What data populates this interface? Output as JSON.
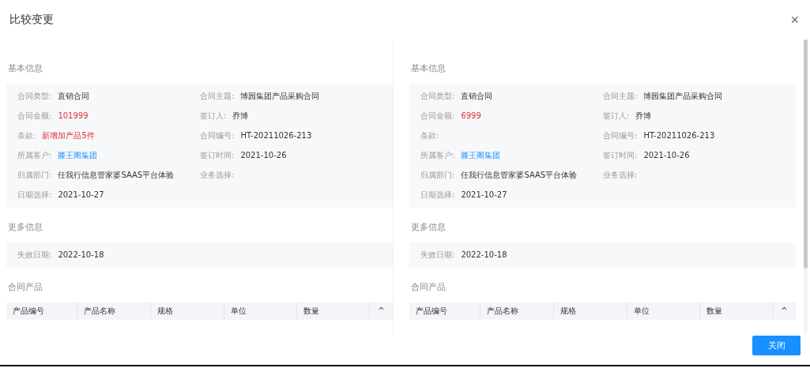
{
  "dialog": {
    "title": "比较变更",
    "close": "×",
    "button": "关闭"
  },
  "panels": [
    {
      "sections": [
        {
          "kind": "fields",
          "title": "基本信息",
          "fields": [
            {
              "label": "合同类型:",
              "value": "直销合同",
              "kind": "text"
            },
            {
              "label": "合同主题:",
              "value": "博园集团产品采购合同",
              "kind": "text"
            },
            {
              "label": "合同金额:",
              "value": "101999",
              "kind": "changed"
            },
            {
              "label": "签订人:",
              "value": "乔博",
              "kind": "text"
            },
            {
              "label": "条款:",
              "value": "新增加产品5件",
              "kind": "changed"
            },
            {
              "label": "合同编号:",
              "value": "HT-20211026-213",
              "kind": "text"
            },
            {
              "label": "所属客户:",
              "value": "滕王阁集团",
              "kind": "link"
            },
            {
              "label": "签订时间:",
              "value": "2021-10-26",
              "kind": "text"
            },
            {
              "label": "归属部门:",
              "value": "任我行信息管家婆SAAS平台体验",
              "kind": "text"
            },
            {
              "label": "业务选择:"
            },
            {
              "label": "日期选择:",
              "value": "2021-10-27",
              "kind": "text"
            }
          ]
        },
        {
          "kind": "fields",
          "title": "更多信息",
          "fields": [
            {
              "label": "失效日期:",
              "value": "2022-10-18",
              "kind": "text"
            }
          ]
        },
        {
          "kind": "table",
          "title": "合同产品",
          "columns": [
            "产品编号",
            "产品名称",
            "规格",
            "单位",
            "数量",
            "^"
          ]
        }
      ]
    },
    {
      "sections": [
        {
          "kind": "fields",
          "title": "基本信息",
          "fields": [
            {
              "label": "合同类型:",
              "value": "直销合同",
              "kind": "text"
            },
            {
              "label": "合同主题:",
              "value": "博园集团产品采购合同",
              "kind": "text"
            },
            {
              "label": "合同金额:",
              "value": "6999",
              "kind": "changed"
            },
            {
              "label": "签订人:",
              "value": "乔博",
              "kind": "text"
            },
            {
              "label": "条款:"
            },
            {
              "label": "合同编号:",
              "value": "HT-20211026-213",
              "kind": "text"
            },
            {
              "label": "所属客户:",
              "value": "滕王阁集团",
              "kind": "link"
            },
            {
              "label": "签订时间:",
              "value": "2021-10-26",
              "kind": "text"
            },
            {
              "label": "归属部门:",
              "value": "任我行信息管家婆SAAS平台体验",
              "kind": "text"
            },
            {
              "label": "业务选择:"
            },
            {
              "label": "日期选择:",
              "value": "2021-10-27",
              "kind": "text"
            }
          ]
        },
        {
          "kind": "fields",
          "title": "更多信息",
          "fields": [
            {
              "label": "失效日期:",
              "value": "2022-10-18",
              "kind": "text"
            }
          ]
        },
        {
          "kind": "table",
          "title": "合同产品",
          "columns": [
            "产品编号",
            "产品名称",
            "规格",
            "单位",
            "数量",
            "^"
          ]
        }
      ]
    }
  ]
}
